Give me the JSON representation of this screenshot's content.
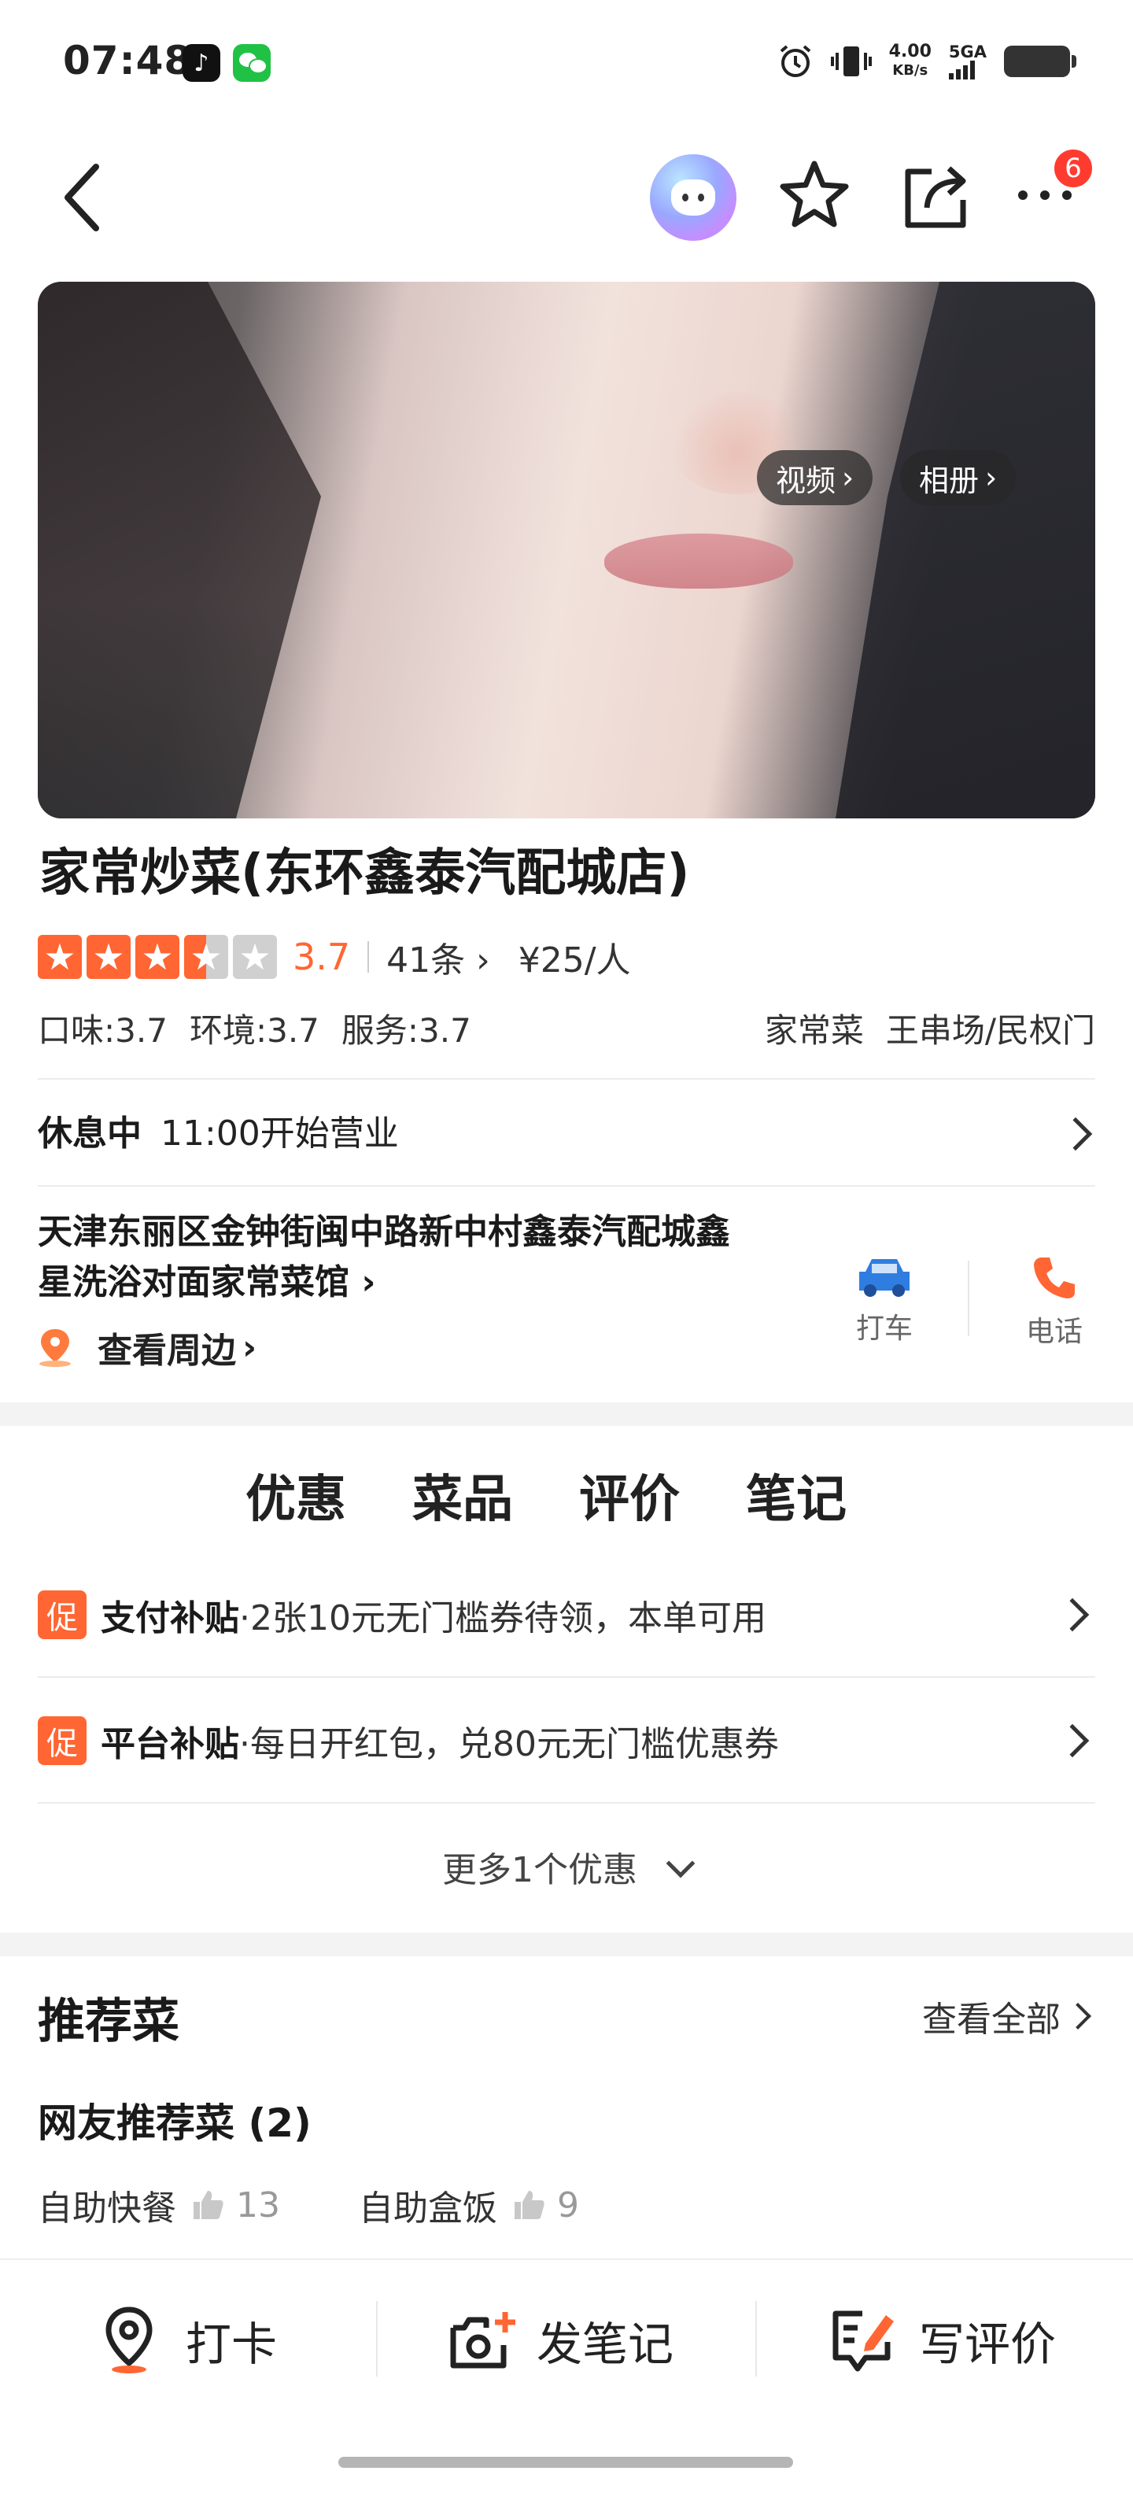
{
  "status_bar": {
    "time": "07:48",
    "net_speed_value": "4.00",
    "net_speed_unit": "KB/s",
    "network": "5GA"
  },
  "header": {
    "notification_count": "6"
  },
  "hero": {
    "video_label": "视频",
    "album_label": "相册"
  },
  "shop": {
    "name": "家常炒菜(东环鑫泰汽配城店)",
    "rating": "3.7",
    "stars": 3.5,
    "reviews": "41条",
    "price": "¥25/人",
    "sub_scores": [
      "口味:3.7",
      "环境:3.7",
      "服务:3.7"
    ],
    "tags": [
      "家常菜",
      "王串场/民权门"
    ],
    "status": "休息中",
    "hours": "11:00开始营业",
    "address_line1": "天津东丽区金钟街闽中路新中村鑫泰汽配城鑫",
    "address_line2": "星洗浴对面家常菜馆",
    "nearby": "查看周边",
    "taxi_label": "打车",
    "phone_label": "电话"
  },
  "tabs": [
    "优惠",
    "菜品",
    "评价",
    "笔记"
  ],
  "promos": [
    {
      "tag": "促",
      "title": "支付补贴",
      "desc": "·2张10元无门槛券待领，本单可用"
    },
    {
      "tag": "促",
      "title": "平台补贴",
      "desc": "·每日开红包，兑80元无门槛优惠券"
    }
  ],
  "more_offers": "更多1个优惠",
  "recommended": {
    "title": "推荐菜",
    "view_all": "查看全部",
    "netizen_title": "网友推荐菜 (2)",
    "dishes": [
      {
        "name": "自助快餐",
        "likes": "13"
      },
      {
        "name": "自助盒饭",
        "likes": "9"
      }
    ]
  },
  "bottom_bar": {
    "checkin": "打卡",
    "post_note": "发笔记",
    "write_review": "写评价"
  },
  "colors": {
    "accent": "#ff6633",
    "badge": "#ff3b30",
    "taxi_blue": "#2f7de1"
  }
}
